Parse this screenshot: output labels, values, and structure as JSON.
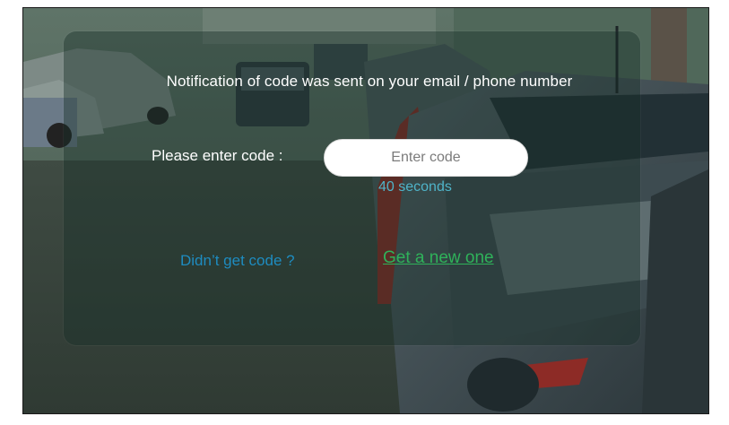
{
  "verification": {
    "notice": "Notification of code was sent on your email / phone number",
    "code_label": "Please enter code :",
    "code_input": {
      "value": "",
      "placeholder": "Enter code"
    },
    "countdown": "40 seconds",
    "resend_prompt": "Didn’t get code ?",
    "resend_link": "Get a new one"
  },
  "colors": {
    "panel_tint": "#183028",
    "countdown_text": "#4fb4c9",
    "prompt_text": "#1e8cc0",
    "link_text": "#2fb25a"
  }
}
